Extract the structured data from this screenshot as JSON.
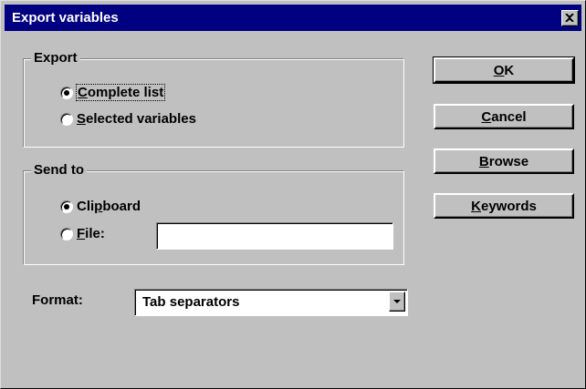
{
  "window": {
    "title": "Export variables",
    "close_icon": "close-x-icon"
  },
  "export_group": {
    "legend": "Export",
    "options": [
      {
        "pre": "",
        "key": "C",
        "post": "omplete list",
        "checked": true
      },
      {
        "pre": "",
        "key": "S",
        "post": "elected variables",
        "checked": false
      }
    ]
  },
  "send_group": {
    "legend": "Send to",
    "clipboard": {
      "pre": "Cli",
      "key": "p",
      "post": "board",
      "checked": true
    },
    "file": {
      "pre": "",
      "key": "F",
      "post": "ile:",
      "checked": false,
      "value": ""
    }
  },
  "format": {
    "label": "Format:",
    "selected": "Tab separators",
    "arrow_icon": "dropdown-arrow-icon"
  },
  "buttons": {
    "ok": {
      "pre": "",
      "key": "O",
      "post": "K"
    },
    "cancel": {
      "pre": "",
      "key": "C",
      "post": "ancel"
    },
    "browse": {
      "pre": "",
      "key": "B",
      "post": "rowse"
    },
    "keywords": {
      "pre": "",
      "key": "K",
      "post": "eywords"
    }
  },
  "colors": {
    "titlebar": "#000080",
    "face": "#c0c0c0"
  }
}
